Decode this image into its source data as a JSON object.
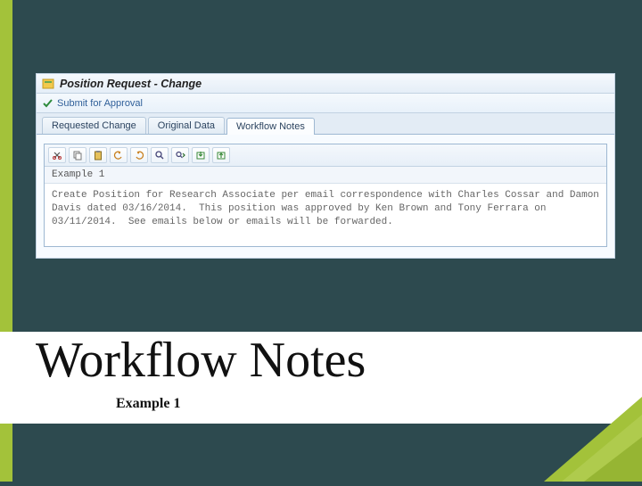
{
  "titlebar": {
    "title": "Position Request - Change"
  },
  "actionbar": {
    "submit_label": "Submit for Approval"
  },
  "tabs": {
    "items": [
      {
        "label": "Requested Change"
      },
      {
        "label": "Original Data"
      },
      {
        "label": "Workflow Notes"
      }
    ],
    "active_index": 2
  },
  "editor": {
    "header": "Example 1",
    "body": "Create Position for Research Associate per email correspondence with Charles Cossar and Damon Davis dated 03/16/2014.  This position was approved by Ken Brown and Tony Ferrara on 03/11/2014.  See emails below or emails will be forwarded."
  },
  "slide": {
    "headline": "Workflow Notes",
    "subhead": "Example 1"
  },
  "colors": {
    "slide_bg": "#2d4a4f",
    "accent": "#a3c23a",
    "pane": "#e8f0f7"
  }
}
